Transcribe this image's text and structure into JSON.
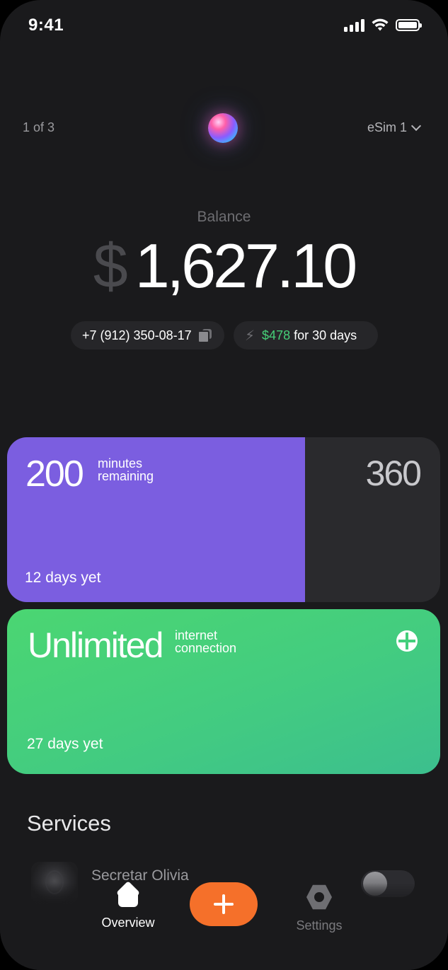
{
  "status_bar": {
    "time": "9:41"
  },
  "header": {
    "page_indicator": "1 of 3",
    "sim_selector": "eSim 1"
  },
  "balance": {
    "label": "Balance",
    "currency": "$",
    "amount": "1,627.10"
  },
  "info_pills": {
    "phone_number": "+7 (912) 350-08-17",
    "plan_price": "$478",
    "plan_period": "for 30 days"
  },
  "minutes_card": {
    "value": "200",
    "caption_line1": "minutes",
    "caption_line2": "remaining",
    "total": "360",
    "days_left": "12 days yet"
  },
  "internet_card": {
    "value": "Unlimited",
    "caption_line1": "internet",
    "caption_line2": "connection",
    "days_left": "27 days yet"
  },
  "services": {
    "title": "Services",
    "items": [
      {
        "name": "Secretar Olivia",
        "enabled": false
      }
    ]
  },
  "tab_bar": {
    "overview_label": "Overview",
    "settings_label": "Settings"
  },
  "colors": {
    "minutes_accent": "#7b5ee0",
    "internet_accent": "#45d07a",
    "add_button": "#f5702a",
    "price_text": "#46cf78"
  }
}
